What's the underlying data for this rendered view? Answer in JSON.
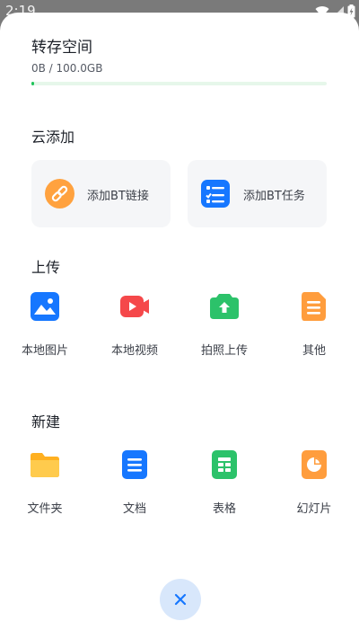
{
  "status_bar": {
    "time": "2:19",
    "icons": [
      "wifi-icon",
      "signal-icon",
      "battery-icon"
    ]
  },
  "storage": {
    "title": "转存空间",
    "usage_text": "0B / 100.0GB",
    "used_fraction": 0.01
  },
  "cloud_add": {
    "heading": "云添加",
    "items": [
      {
        "label": "添加BT链接",
        "icon": "link-icon",
        "color": "#ffa23f"
      },
      {
        "label": "添加BT任务",
        "icon": "task-list-icon",
        "color": "#1677ff"
      }
    ]
  },
  "upload": {
    "heading": "上传",
    "items": [
      {
        "label": "本地图片",
        "icon": "image-icon",
        "color": "#1677ff"
      },
      {
        "label": "本地视频",
        "icon": "video-icon",
        "color": "#f5484a"
      },
      {
        "label": "拍照上传",
        "icon": "camera-upload-icon",
        "color": "#2cc26a"
      },
      {
        "label": "其他",
        "icon": "document-icon",
        "color": "#ff9d3d"
      }
    ]
  },
  "create": {
    "heading": "新建",
    "items": [
      {
        "label": "文件夹",
        "icon": "folder-icon",
        "color": "#ffc53d"
      },
      {
        "label": "文档",
        "icon": "doc-icon",
        "color": "#1677ff"
      },
      {
        "label": "表格",
        "icon": "sheet-icon",
        "color": "#2cc26a"
      },
      {
        "label": "幻灯片",
        "icon": "slides-icon",
        "color": "#ff9d3d"
      }
    ]
  },
  "close_button": {
    "icon": "close-icon"
  }
}
